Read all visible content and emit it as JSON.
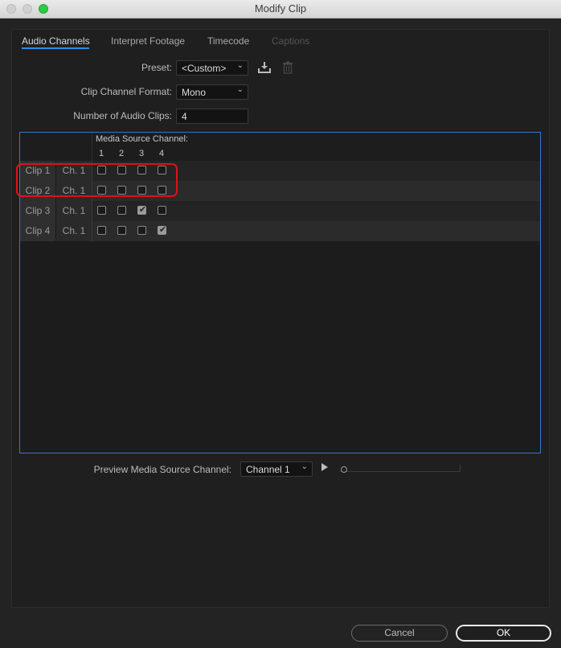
{
  "window": {
    "title": "Modify Clip"
  },
  "tabs": [
    {
      "label": "Audio Channels",
      "state": "active"
    },
    {
      "label": "Interpret Footage",
      "state": "normal"
    },
    {
      "label": "Timecode",
      "state": "normal"
    },
    {
      "label": "Captions",
      "state": "disabled"
    }
  ],
  "preset": {
    "label": "Preset:",
    "value": "<Custom>"
  },
  "format": {
    "label": "Clip Channel Format:",
    "value": "Mono"
  },
  "audio_clips": {
    "label": "Number of Audio Clips:",
    "value": "4"
  },
  "grid": {
    "header": "Media Source Channel:",
    "channels": [
      "1",
      "2",
      "3",
      "4"
    ],
    "rows": [
      {
        "clip": "Clip 1",
        "channel": "Ch. 1",
        "checks": [
          false,
          false,
          false,
          false
        ]
      },
      {
        "clip": "Clip 2",
        "channel": "Ch. 1",
        "checks": [
          false,
          false,
          false,
          false
        ]
      },
      {
        "clip": "Clip 3",
        "channel": "Ch. 1",
        "checks": [
          false,
          false,
          true,
          false
        ]
      },
      {
        "clip": "Clip 4",
        "channel": "Ch. 1",
        "checks": [
          false,
          false,
          false,
          true
        ]
      }
    ]
  },
  "preview": {
    "label": "Preview Media Source Channel:",
    "value": "Channel 1"
  },
  "buttons": {
    "cancel": "Cancel",
    "ok": "OK"
  },
  "icons": {
    "preset_save": "download-preset-icon",
    "preset_delete": "trash-icon",
    "play": "play-icon"
  },
  "colors": {
    "accent": "#2d8ceb",
    "highlight": "#e0101a"
  }
}
